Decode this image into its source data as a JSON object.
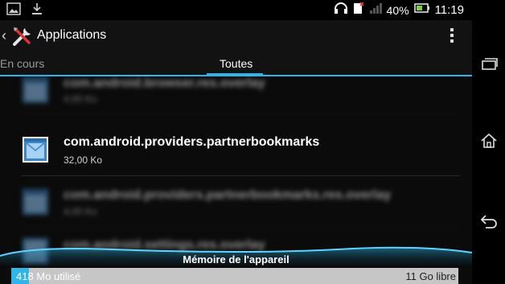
{
  "statusbar": {
    "battery": "40%",
    "time": "11:19",
    "icons": [
      "image-icon",
      "download-icon",
      "headset-icon",
      "sim-error-icon",
      "signal-icon",
      "battery-icon"
    ]
  },
  "actionbar": {
    "title": "Applications",
    "icons": [
      "back-icon",
      "tools-icon",
      "overflow-menu-icon"
    ]
  },
  "tabs": [
    {
      "label": "En cours",
      "selected": false
    },
    {
      "label": "Toutes",
      "selected": true
    }
  ],
  "apps": [
    {
      "name": "com.android.browser.res.overlay",
      "size": "4,00 Ko",
      "blurred": true
    },
    {
      "name": "com.android.providers.partnerbookmarks",
      "size": "32,00 Ko",
      "blurred": false
    },
    {
      "name": "com.android.providers.partnerbookmarks.res.overlay",
      "size": "4,00 Ko",
      "blurred": true
    },
    {
      "name": "com.android.settings.res.overlay",
      "size": "",
      "blurred": true
    }
  ],
  "memory": {
    "title": "Mémoire de l'appareil",
    "used": "418 Mo utilisé",
    "free": "11 Go libre",
    "used_fraction": 0.04
  },
  "colors": {
    "accent": "#2fb5e8",
    "background": "#0b0b0b"
  }
}
